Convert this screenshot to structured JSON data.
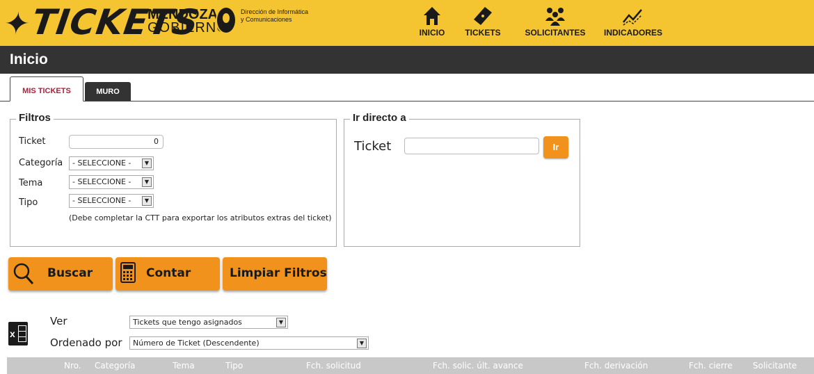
{
  "app": {
    "brand": "TICKETS",
    "gov_line1": "MENDOZA",
    "gov_line2": "GOBIERNO",
    "dir_line1": "Dirección de Informática",
    "dir_line2": "y Comunicaciones",
    "brand_color": "#f5c431"
  },
  "nav": {
    "inicio": "INICIO",
    "tickets": "TICKETS",
    "solicitantes": "SOLICITANTES",
    "indicadores": "INDICADORES"
  },
  "page": {
    "title": "Inicio"
  },
  "tabs": [
    {
      "label": "MIS TICKETS",
      "active": true
    },
    {
      "label": "MURO",
      "active": false
    }
  ],
  "filtros": {
    "legend": "Filtros",
    "ticket_label": "Ticket",
    "ticket_value": "0",
    "categoria_label": "Categoría",
    "categoria_value": "- SELECCIONE -",
    "tema_label": "Tema",
    "tema_value": "- SELECCIONE -",
    "tipo_label": "Tipo",
    "tipo_value": "- SELECCIONE -",
    "note": "(Debe completar la CTT para exportar los atributos extras del ticket)"
  },
  "ir_directo": {
    "legend": "Ir directo a",
    "ticket_label": "Ticket",
    "ticket_value": "",
    "button": "Ir"
  },
  "actions": {
    "buscar": "Buscar",
    "contar": "Contar",
    "limpiar": "Limpiar Filtros",
    "accent_color": "#f0921c"
  },
  "list": {
    "ver_label": "Ver",
    "ver_value": "Tickets que tengo asignados",
    "orden_label": "Ordenado por",
    "orden_value": "Número de Ticket (Descendente)"
  },
  "table": {
    "columns": [
      "Nro.",
      "Categoría",
      "Tema",
      "Tipo",
      "Fch. solicitud",
      "Fch. solic. últ. avance",
      "Fch. derivación",
      "Fch. cierre",
      "Solicitante"
    ]
  }
}
